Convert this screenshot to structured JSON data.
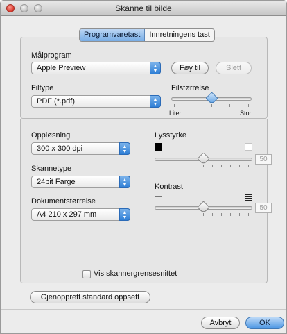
{
  "window": {
    "title": "Skanne til bilde"
  },
  "tabs": [
    {
      "label": "Programvaretast",
      "active": true
    },
    {
      "label": "Innretningens tast",
      "active": false
    }
  ],
  "target_app": {
    "label": "Målprogram",
    "value": "Apple Preview",
    "add_button": "Føy til",
    "delete_button": "Slett"
  },
  "file_type": {
    "label": "Filtype",
    "value": "PDF (*.pdf)"
  },
  "file_size": {
    "label": "Filstørrelse",
    "min_label": "Liten",
    "max_label": "Stor",
    "level": 0.5
  },
  "resolution": {
    "label": "Oppløsning",
    "value": "300 x 300 dpi"
  },
  "scan_type": {
    "label": "Skannetype",
    "value": "24bit Farge"
  },
  "document_size": {
    "label": "Dokumentstørrelse",
    "value": "A4  210 x 297 mm"
  },
  "brightness": {
    "label": "Lysstyrke",
    "value": "50",
    "level": 0.5
  },
  "contrast": {
    "label": "Kontrast",
    "value": "50",
    "level": 0.5
  },
  "show_scanner_interface": {
    "label": "Vis skannergrensesnittet",
    "checked": false
  },
  "buttons": {
    "restore_defaults": "Gjenopprett standard oppsett",
    "cancel": "Avbryt",
    "ok": "OK"
  },
  "colors": {
    "accent": "#4c97e4"
  }
}
